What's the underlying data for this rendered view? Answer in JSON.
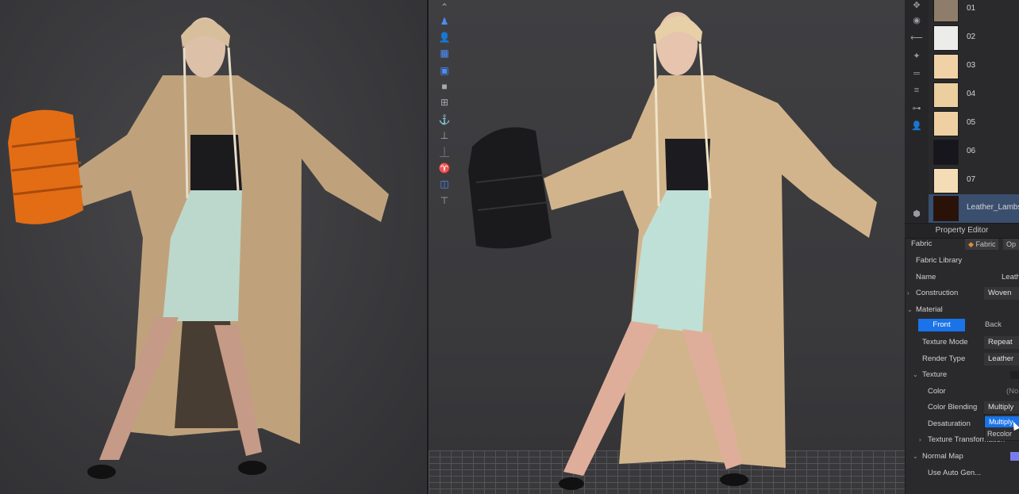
{
  "fabric_list": {
    "items": [
      {
        "label": "01",
        "color": "#8f7d6b"
      },
      {
        "label": "02",
        "color": "#ececea"
      },
      {
        "label": "03",
        "color": "#f0d2a6"
      },
      {
        "label": "04",
        "color": "#ecce9f"
      },
      {
        "label": "05",
        "color": "#eed0a2"
      },
      {
        "label": "06",
        "color": "#16161c"
      },
      {
        "label": "07",
        "color": "#f4dcb6"
      },
      {
        "label": "Leather_Lambski",
        "color": "#2a1208",
        "selected": true
      }
    ]
  },
  "property_editor": {
    "title": "Property Editor",
    "fabric_label": "Fabric",
    "tab_fabric": "Fabric",
    "tab_other": "Op",
    "fabric_library": "Fabric Library",
    "name_label": "Name",
    "name_value": "Leath",
    "construction_label": "Construction",
    "construction_value": "Woven",
    "material_label": "Material",
    "front_label": "Front",
    "back_label": "Back",
    "texture_mode_label": "Texture Mode",
    "texture_mode_value": "Repeat",
    "render_type_label": "Render Type",
    "render_type_value": "Leather",
    "texture_label": "Texture",
    "color_label": "Color",
    "color_value": "(No",
    "color_blending_label": "Color Blending",
    "color_blending_value": "Multiply",
    "desaturation_label": "Desaturation",
    "texture_transformation_label": "Texture Transformation",
    "normal_map_label": "Normal Map",
    "use_auto_gen_label": "Use Auto Gen..."
  },
  "dropdown": {
    "options": [
      "Multiply",
      "Recolor"
    ]
  },
  "colors": {
    "accent": "#1a73e8",
    "panel_bg": "#2a2a2c",
    "viewport_bg": "#3a3a3d"
  }
}
